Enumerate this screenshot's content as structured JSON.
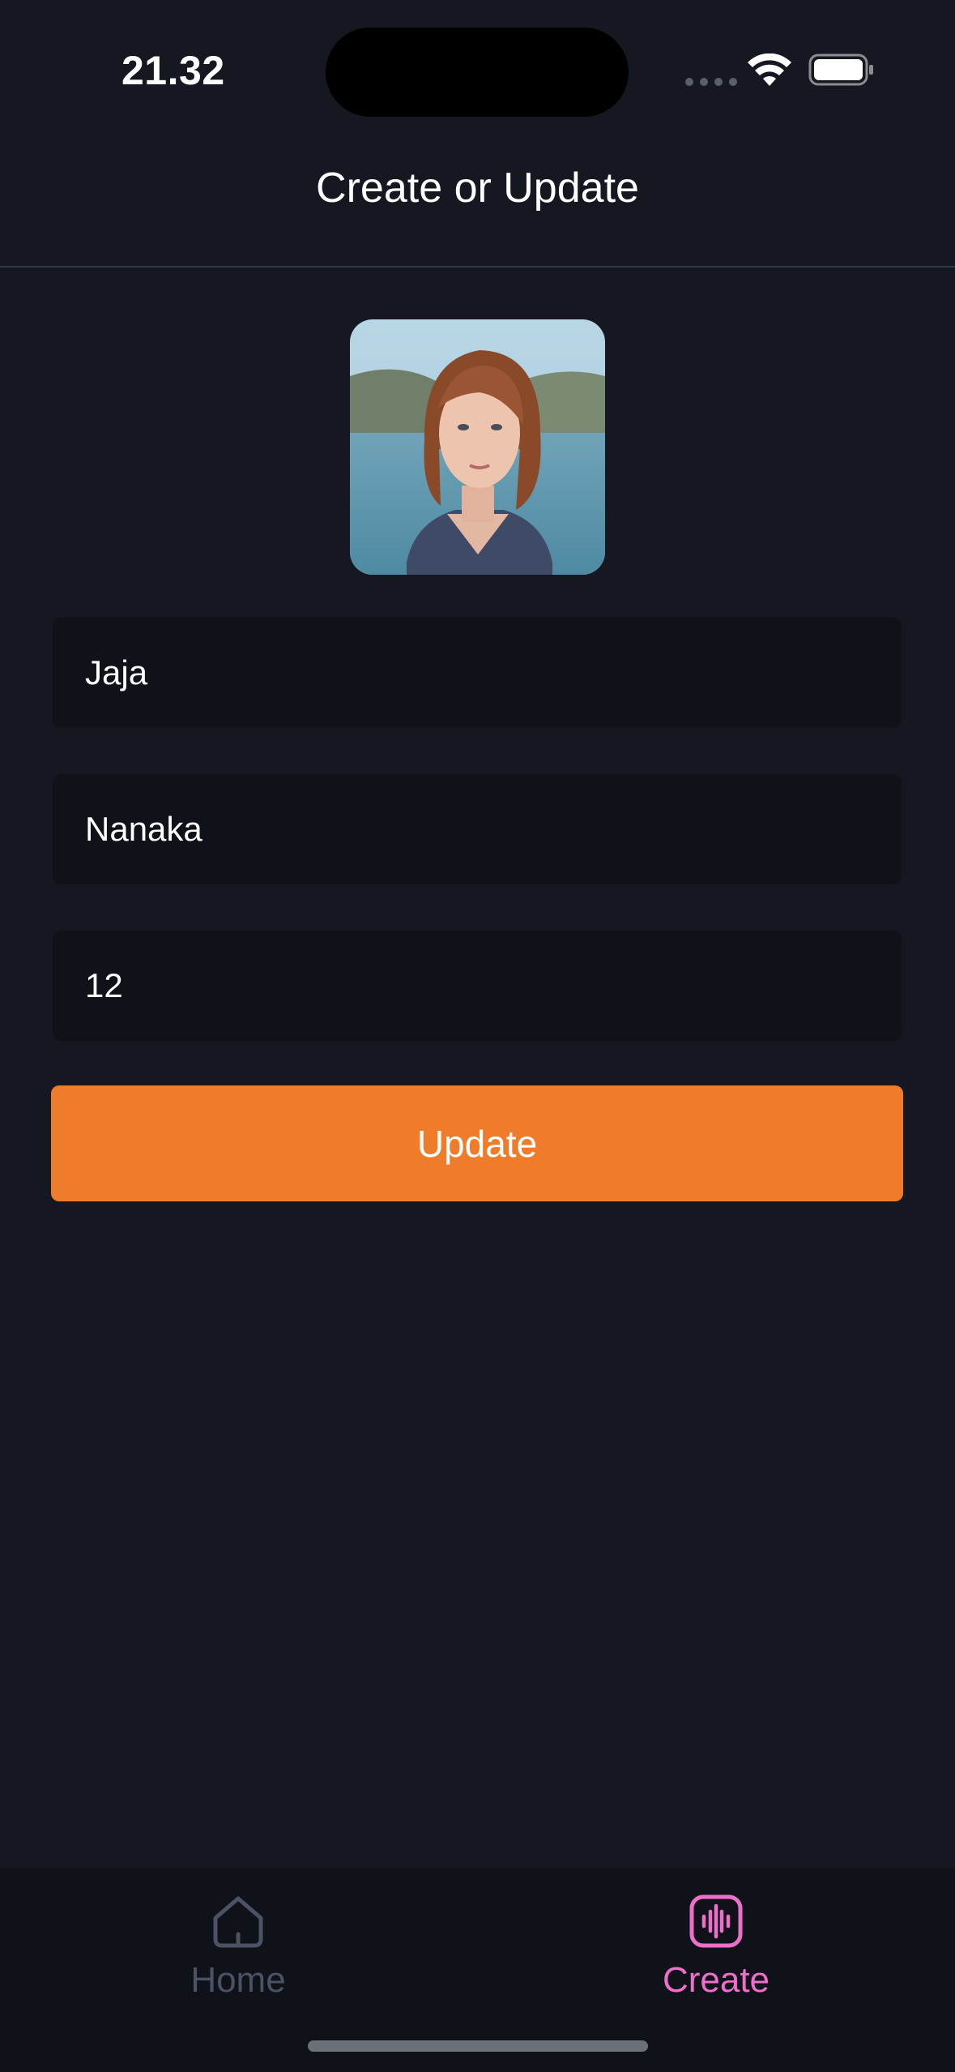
{
  "status_bar": {
    "time": "21.32"
  },
  "header": {
    "title": "Create or Update"
  },
  "form": {
    "first_name_value": "Jaja",
    "last_name_value": "Nanaka",
    "age_value": "12",
    "submit_label": "Update"
  },
  "tab_bar": {
    "tabs": [
      {
        "label": "Home",
        "icon": "home-icon",
        "active": false
      },
      {
        "label": "Create",
        "icon": "audio-waveform-icon",
        "active": true
      }
    ]
  },
  "colors": {
    "background": "#151821",
    "field_background": "#10121a",
    "accent_button": "#ef7c2a",
    "active_tab": "#ec6fc9",
    "inactive_tab": "#4a5264"
  }
}
